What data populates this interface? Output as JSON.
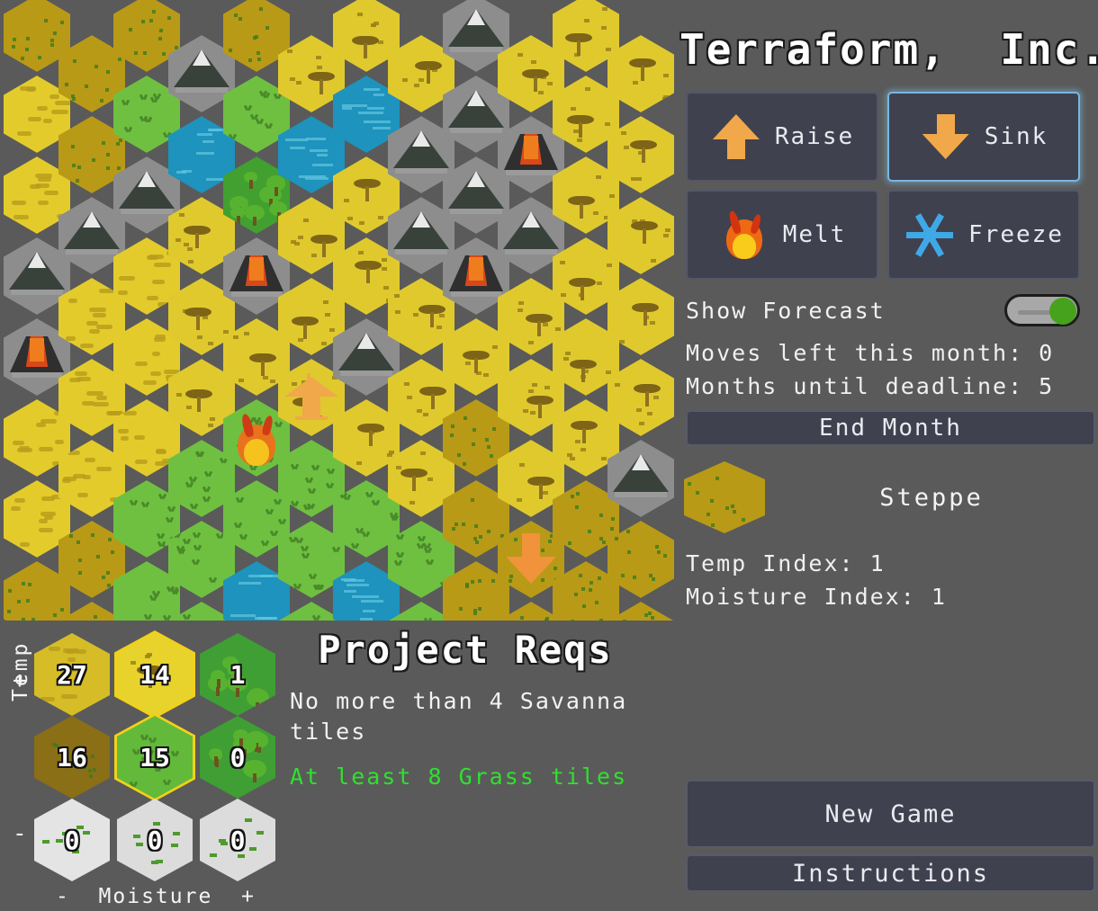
{
  "app": {
    "title": "Terraform,  Inc."
  },
  "tools": [
    {
      "id": "raise",
      "label": "Raise",
      "icon": "arrow-up-icon",
      "selected": false
    },
    {
      "id": "sink",
      "label": "Sink",
      "icon": "arrow-down-icon",
      "selected": true
    },
    {
      "id": "melt",
      "label": "Melt",
      "icon": "fire-icon",
      "selected": false
    },
    {
      "id": "freeze",
      "label": "Freeze",
      "icon": "snowflake-icon",
      "selected": false
    }
  ],
  "forecast": {
    "label": "Show Forecast",
    "enabled": true
  },
  "status": {
    "moves_left": "Moves left this month: 0",
    "deadline": "Months until deadline: 5"
  },
  "buttons": {
    "end_month": "End Month",
    "new_game": "New Game",
    "instructions": "Instructions"
  },
  "selected_tile": {
    "name": "Steppe",
    "color": "#b89a16",
    "temp_index": "Temp Index: 1",
    "moisture_index": "Moisture Index: 1"
  },
  "project_reqs": {
    "title": "Project Reqs",
    "items": [
      {
        "text": "No more than 4 Savanna tiles",
        "met": false
      },
      {
        "text": "At least 8 Grass tiles",
        "met": true
      }
    ]
  },
  "biome_matrix": {
    "temp_axis_label": "Temp",
    "temp_plus": "+",
    "temp_minus": "-",
    "moisture_axis_label": "-  Moisture  +",
    "cells": [
      {
        "row": 0,
        "col": 0,
        "biome": "desert",
        "count": "27",
        "selected": false,
        "color": "#d6bd27"
      },
      {
        "row": 0,
        "col": 1,
        "biome": "savanna",
        "count": "14",
        "selected": true,
        "color": "#e8d32c"
      },
      {
        "row": 0,
        "col": 2,
        "biome": "jungle",
        "count": "1",
        "selected": false,
        "color": "#3f9e34"
      },
      {
        "row": 1,
        "col": 0,
        "biome": "steppe",
        "count": "16",
        "selected": false,
        "color": "#8a6f16"
      },
      {
        "row": 1,
        "col": 1,
        "biome": "grass",
        "count": "15",
        "selected": true,
        "color": "#63b93a"
      },
      {
        "row": 1,
        "col": 2,
        "biome": "forest",
        "count": "0",
        "selected": false,
        "color": "#3f9e34"
      },
      {
        "row": 2,
        "col": 0,
        "biome": "ice",
        "count": "0",
        "selected": false,
        "color": "#e4e4e4"
      },
      {
        "row": 2,
        "col": 1,
        "biome": "tundra",
        "count": "0",
        "selected": false,
        "color": "#dcdcdc"
      },
      {
        "row": 2,
        "col": 2,
        "biome": "taiga",
        "count": "0",
        "selected": false,
        "color": "#dcdcdc"
      }
    ]
  },
  "map": {
    "cols": 12,
    "rows": 8,
    "hex_width": 74,
    "hex_height": 86,
    "col_pitch": 61,
    "row_pitch": 90,
    "tiles": [
      {
        "c": 0,
        "r": 0,
        "t": "steppe"
      },
      {
        "c": 0,
        "r": 1,
        "t": "desert"
      },
      {
        "c": 0,
        "r": 2,
        "t": "desert"
      },
      {
        "c": 0,
        "r": 3,
        "t": "mountain"
      },
      {
        "c": 0,
        "r": 4,
        "t": "volcano"
      },
      {
        "c": 0,
        "r": 5,
        "t": "desert"
      },
      {
        "c": 0,
        "r": 6,
        "t": "desert"
      },
      {
        "c": 0,
        "r": 7,
        "t": "steppe"
      },
      {
        "c": 1,
        "r": 0,
        "t": "steppe"
      },
      {
        "c": 1,
        "r": 1,
        "t": "steppe"
      },
      {
        "c": 1,
        "r": 2,
        "t": "mountain"
      },
      {
        "c": 1,
        "r": 3,
        "t": "desert"
      },
      {
        "c": 1,
        "r": 4,
        "t": "desert"
      },
      {
        "c": 1,
        "r": 5,
        "t": "desert"
      },
      {
        "c": 1,
        "r": 6,
        "t": "steppe"
      },
      {
        "c": 1,
        "r": 7,
        "t": "steppe"
      },
      {
        "c": 2,
        "r": 0,
        "t": "steppe"
      },
      {
        "c": 2,
        "r": 1,
        "t": "grass"
      },
      {
        "c": 2,
        "r": 2,
        "t": "mountain"
      },
      {
        "c": 2,
        "r": 3,
        "t": "desert"
      },
      {
        "c": 2,
        "r": 4,
        "t": "desert"
      },
      {
        "c": 2,
        "r": 5,
        "t": "desert"
      },
      {
        "c": 2,
        "r": 6,
        "t": "grass"
      },
      {
        "c": 2,
        "r": 7,
        "t": "grass"
      },
      {
        "c": 3,
        "r": 0,
        "t": "mountain"
      },
      {
        "c": 3,
        "r": 1,
        "t": "water"
      },
      {
        "c": 3,
        "r": 2,
        "t": "savanna"
      },
      {
        "c": 3,
        "r": 3,
        "t": "savanna"
      },
      {
        "c": 3,
        "r": 4,
        "t": "savanna"
      },
      {
        "c": 3,
        "r": 5,
        "t": "grass"
      },
      {
        "c": 3,
        "r": 6,
        "t": "grass"
      },
      {
        "c": 3,
        "r": 7,
        "t": "grass"
      },
      {
        "c": 4,
        "r": 0,
        "t": "steppe"
      },
      {
        "c": 4,
        "r": 1,
        "t": "grass"
      },
      {
        "c": 4,
        "r": 2,
        "t": "jungle"
      },
      {
        "c": 4,
        "r": 3,
        "t": "volcano"
      },
      {
        "c": 4,
        "r": 4,
        "t": "savanna"
      },
      {
        "c": 4,
        "r": 5,
        "t": "grass",
        "overlay": "fire"
      },
      {
        "c": 4,
        "r": 6,
        "t": "grass"
      },
      {
        "c": 4,
        "r": 7,
        "t": "water"
      },
      {
        "c": 5,
        "r": 0,
        "t": "savanna"
      },
      {
        "c": 5,
        "r": 1,
        "t": "water"
      },
      {
        "c": 5,
        "r": 2,
        "t": "savanna"
      },
      {
        "c": 5,
        "r": 3,
        "t": "savanna"
      },
      {
        "c": 5,
        "r": 4,
        "t": "savanna",
        "overlay": "house"
      },
      {
        "c": 5,
        "r": 5,
        "t": "grass"
      },
      {
        "c": 5,
        "r": 6,
        "t": "grass"
      },
      {
        "c": 5,
        "r": 7,
        "t": "grass"
      },
      {
        "c": 6,
        "r": 0,
        "t": "savanna"
      },
      {
        "c": 6,
        "r": 1,
        "t": "water"
      },
      {
        "c": 6,
        "r": 2,
        "t": "savanna"
      },
      {
        "c": 6,
        "r": 3,
        "t": "savanna"
      },
      {
        "c": 6,
        "r": 4,
        "t": "mountain"
      },
      {
        "c": 6,
        "r": 5,
        "t": "savanna"
      },
      {
        "c": 6,
        "r": 6,
        "t": "grass"
      },
      {
        "c": 6,
        "r": 7,
        "t": "water"
      },
      {
        "c": 7,
        "r": 0,
        "t": "savanna"
      },
      {
        "c": 7,
        "r": 1,
        "t": "mountain"
      },
      {
        "c": 7,
        "r": 2,
        "t": "mountain"
      },
      {
        "c": 7,
        "r": 3,
        "t": "savanna"
      },
      {
        "c": 7,
        "r": 4,
        "t": "savanna"
      },
      {
        "c": 7,
        "r": 5,
        "t": "savanna"
      },
      {
        "c": 7,
        "r": 6,
        "t": "grass"
      },
      {
        "c": 7,
        "r": 7,
        "t": "grass"
      },
      {
        "c": 8,
        "r": 0,
        "t": "mountain"
      },
      {
        "c": 8,
        "r": 1,
        "t": "mountain"
      },
      {
        "c": 8,
        "r": 2,
        "t": "mountain"
      },
      {
        "c": 8,
        "r": 3,
        "t": "volcano"
      },
      {
        "c": 8,
        "r": 4,
        "t": "savanna"
      },
      {
        "c": 8,
        "r": 5,
        "t": "steppe"
      },
      {
        "c": 8,
        "r": 6,
        "t": "steppe"
      },
      {
        "c": 8,
        "r": 7,
        "t": "steppe"
      },
      {
        "c": 9,
        "r": 0,
        "t": "savanna"
      },
      {
        "c": 9,
        "r": 1,
        "t": "volcano"
      },
      {
        "c": 9,
        "r": 2,
        "t": "mountain"
      },
      {
        "c": 9,
        "r": 3,
        "t": "savanna"
      },
      {
        "c": 9,
        "r": 4,
        "t": "savanna"
      },
      {
        "c": 9,
        "r": 5,
        "t": "savanna"
      },
      {
        "c": 9,
        "r": 6,
        "t": "steppe",
        "overlay": "down"
      },
      {
        "c": 9,
        "r": 7,
        "t": "steppe"
      },
      {
        "c": 10,
        "r": 0,
        "t": "savanna"
      },
      {
        "c": 10,
        "r": 1,
        "t": "savanna"
      },
      {
        "c": 10,
        "r": 2,
        "t": "savanna"
      },
      {
        "c": 10,
        "r": 3,
        "t": "savanna"
      },
      {
        "c": 10,
        "r": 4,
        "t": "savanna"
      },
      {
        "c": 10,
        "r": 5,
        "t": "savanna"
      },
      {
        "c": 10,
        "r": 6,
        "t": "steppe"
      },
      {
        "c": 10,
        "r": 7,
        "t": "steppe"
      },
      {
        "c": 11,
        "r": 0,
        "t": "savanna"
      },
      {
        "c": 11,
        "r": 1,
        "t": "savanna"
      },
      {
        "c": 11,
        "r": 2,
        "t": "savanna"
      },
      {
        "c": 11,
        "r": 3,
        "t": "savanna"
      },
      {
        "c": 11,
        "r": 4,
        "t": "savanna"
      },
      {
        "c": 11,
        "r": 5,
        "t": "mountain"
      },
      {
        "c": 11,
        "r": 6,
        "t": "steppe"
      },
      {
        "c": 11,
        "r": 7,
        "t": "steppe"
      }
    ]
  }
}
